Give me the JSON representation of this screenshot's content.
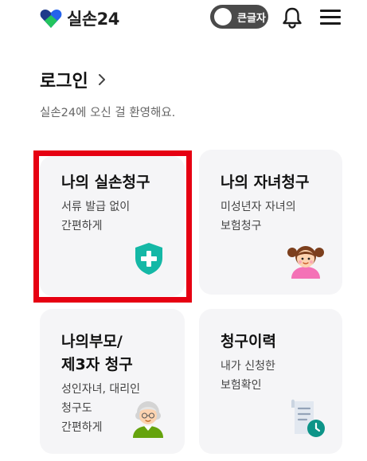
{
  "header": {
    "logo_text": "실손24",
    "logo_icon": "heart-logo-icon",
    "toggle_label": "큰글자",
    "bell_icon": "bell-icon",
    "menu_icon": "hamburger-menu-icon"
  },
  "login": {
    "title": "로그인",
    "chevron_icon": "chevron-right-icon"
  },
  "welcome": "실손24에 오신 걸 환영해요.",
  "cards": [
    {
      "title": "나의 실손청구",
      "desc_line1": "서류 발급 없이",
      "desc_line2": "간편하게",
      "icon": "shield-plus-icon"
    },
    {
      "title": "나의 자녀청구",
      "desc_line1": "미성년자 자녀의",
      "desc_line2": "보험청구",
      "icon": "girl-avatar-icon"
    },
    {
      "title_line1": "나의부모/",
      "title_line2": "제3자 청구",
      "desc_line1": "성인자녀, 대리인",
      "desc_line2": "청구도",
      "desc_line3": "간편하게",
      "icon": "grandparent-avatar-icon"
    },
    {
      "title": "청구이력",
      "desc_line1": "내가 신청한",
      "desc_line2": "보험확인",
      "icon": "document-history-icon"
    }
  ],
  "colors": {
    "accent_teal": "#14b8a6",
    "logo_blue": "#1d4ed8",
    "highlight_red": "#e60012",
    "card_bg": "#f5f5f7"
  }
}
